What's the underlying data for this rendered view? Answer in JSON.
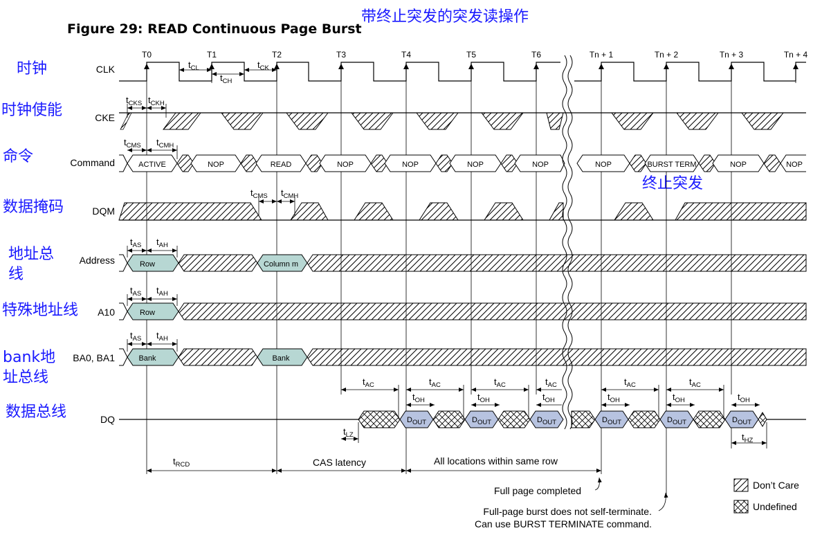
{
  "figure_title": "Figure 29: READ Continuous Page Burst",
  "title_annotation": "带终止突发的突发读操作",
  "time_labels": [
    "T0",
    "T1",
    "T2",
    "T3",
    "T4",
    "T5",
    "T6",
    "Tn + 1",
    "Tn + 2",
    "Tn + 3",
    "Tn + 4"
  ],
  "signals": {
    "clk": "CLK",
    "cke": "CKE",
    "command": "Command",
    "dqm": "DQM",
    "address": "Address",
    "a10": "A10",
    "ba": "BA0, BA1",
    "dq": "DQ"
  },
  "annotations_cn": {
    "clk": "时钟",
    "cke": "时钟使能",
    "command": "命令",
    "dqm": "数据掩码",
    "address_l1": "地址总",
    "address_l2": "线",
    "a10": "特殊地址线",
    "ba_l1": "bank地",
    "ba_l2": "址总线",
    "dq": "数据总线",
    "burst_term": "终止突发"
  },
  "commands": [
    "ACTIVE",
    "NOP",
    "READ",
    "NOP",
    "NOP",
    "NOP",
    "NOP",
    "NOP",
    "BURST TERM",
    "NOP",
    "NOP"
  ],
  "address_value": "Row",
  "address_column": "Column m",
  "a10_value": "Row",
  "bank_value": "Bank",
  "bank_value_2": "Bank",
  "dout": {
    "main": "D",
    "sub": "OUT"
  },
  "timing": {
    "cl": {
      "t": "t",
      "sub": "CL"
    },
    "ch": {
      "t": "t",
      "sub": "CH"
    },
    "ck": {
      "t": "t",
      "sub": "CK"
    },
    "cks": {
      "t": "t",
      "sub": "CKS"
    },
    "ckh": {
      "t": "t",
      "sub": "CKH"
    },
    "cms": {
      "t": "t",
      "sub": "CMS"
    },
    "cmh": {
      "t": "t",
      "sub": "CMH"
    },
    "as": {
      "t": "t",
      "sub": "AS"
    },
    "ah": {
      "t": "t",
      "sub": "AH"
    },
    "ac": {
      "t": "t",
      "sub": "AC"
    },
    "oh": {
      "t": "t",
      "sub": "OH"
    },
    "lz": {
      "t": "t",
      "sub": "LZ"
    },
    "hz": {
      "t": "t",
      "sub": "HZ"
    },
    "rcd": {
      "t": "t",
      "sub": "RCD"
    }
  },
  "cas_latency": "CAS latency",
  "all_locations": "All locations within same row",
  "full_page_completed": "Full page completed",
  "self_terminate_l1": "Full-page burst does not self-terminate.",
  "self_terminate_l2": "Can use BURST TERMINATE command.",
  "legend": {
    "dont_care": "Don’t Care",
    "undefined": "Undefined"
  }
}
